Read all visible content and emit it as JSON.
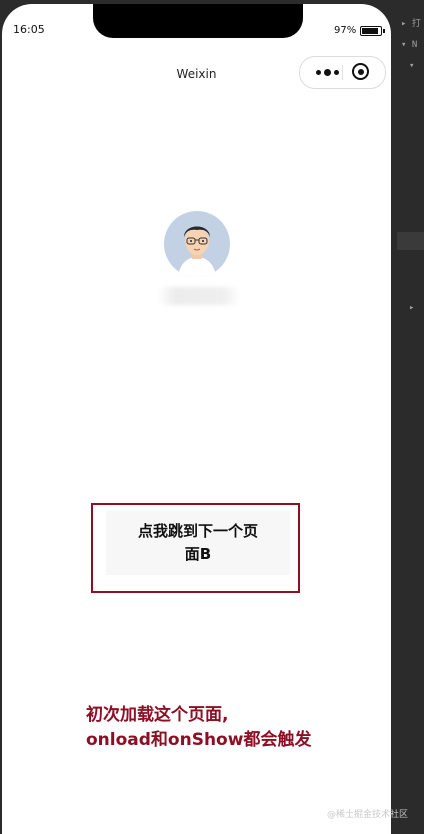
{
  "status_bar": {
    "time": "16:05",
    "battery_percent": "97%",
    "battery_level": 0.97
  },
  "nav": {
    "title": "Weixin"
  },
  "capsule": {
    "more_icon": "more-dots-icon",
    "close_icon": "target-icon"
  },
  "profile": {
    "avatar_icon": "cartoon-avatar-icon"
  },
  "main": {
    "button_line1": "点我跳到下一个页",
    "button_line2": "面B"
  },
  "annotation": {
    "line1": "初次加载这个页面,",
    "line2": "onload和onShow都会触发"
  },
  "watermark": "@稀土掘金技术社区",
  "devtools": {
    "rows": [
      "▸ 打",
      "▾ N",
      "▾",
      "▸"
    ]
  },
  "colors": {
    "annotation": "#8d0f24",
    "page_bg": "#ffffff",
    "button_bg": "#f7f7f7"
  }
}
